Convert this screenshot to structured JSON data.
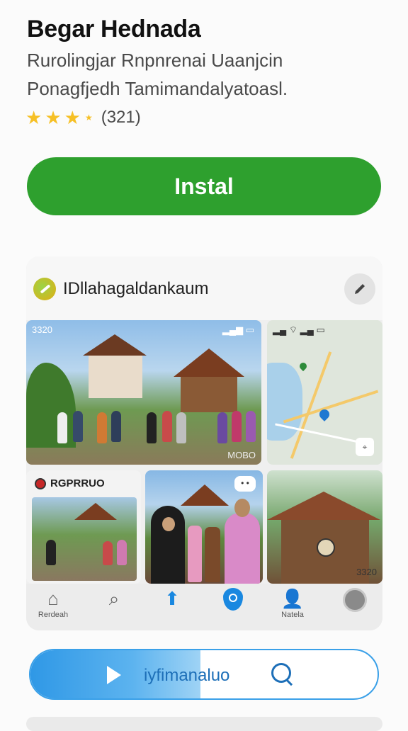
{
  "app": {
    "title": "Begar Hednada",
    "subtitle_line1": "Rurolingjar Rnpnrenai Uaanjcin",
    "subtitle_line2": "Ponagfjedh Tamimandalyatoasl.",
    "rating_count": "(321)",
    "rating_stars": 3.5
  },
  "install": {
    "label": "Instal"
  },
  "preview": {
    "title": "IDllahagaldankaum",
    "edit_icon": "pencil-icon",
    "tile1": {
      "status_time": "3320",
      "watermark": "MOBO"
    },
    "tile3": {
      "label": "RGPRRUO"
    },
    "tile4": {
      "bubble": "• •"
    },
    "tile5": {
      "badge": "3320"
    },
    "nav": [
      {
        "icon": "home-icon",
        "label": "Rerdeah"
      },
      {
        "icon": "search-icon",
        "label": ""
      },
      {
        "icon": "upload-icon",
        "label": ""
      },
      {
        "icon": "shield-icon",
        "label": ""
      },
      {
        "icon": "user-icon",
        "label": "Natela"
      },
      {
        "icon": "disc-icon",
        "label": ""
      }
    ]
  },
  "player": {
    "label": "iyfimanaluo",
    "progress": 0.49
  },
  "colors": {
    "install_green": "#2ea02e",
    "accent_blue": "#1a88e0",
    "star_yellow": "#f6c026"
  }
}
